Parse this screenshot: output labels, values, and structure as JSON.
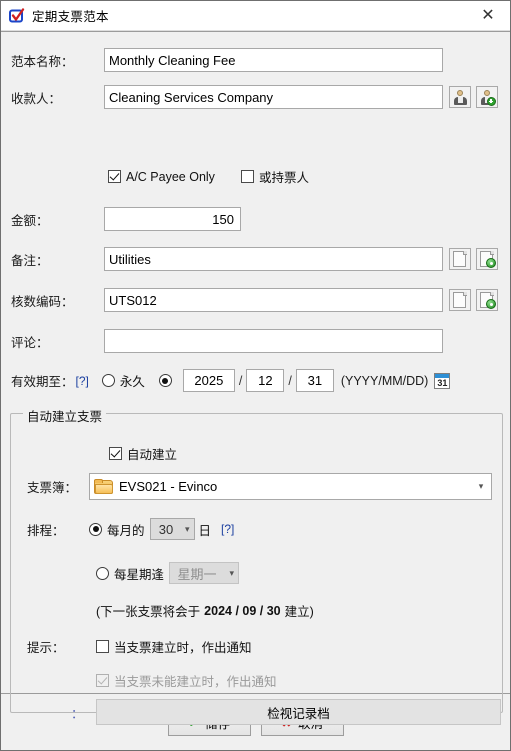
{
  "window": {
    "title": "定期支票范本",
    "icon": "cheque-check-icon",
    "close_label": "✕"
  },
  "form": {
    "template_name": {
      "label": "范本名称：",
      "value": "Monthly Cleaning Fee"
    },
    "payee": {
      "label": "收款人：",
      "value": "Cleaning Services Company",
      "select_payee_icon": "person-icon",
      "add_payee_icon": "person-add-icon"
    },
    "ac_payee_only": {
      "label": "A/C Payee Only",
      "checked": true
    },
    "or_bearer": {
      "label": "或持票人",
      "checked": false
    },
    "amount": {
      "label": "金额：",
      "value": "150"
    },
    "memo": {
      "label": "备注：",
      "value": "Utilities",
      "pick_icon": "document-icon",
      "add_icon": "document-add-icon"
    },
    "audit_code": {
      "label": "核数编码：",
      "value": "UTS012",
      "pick_icon": "document-icon",
      "add_icon": "document-add-icon"
    },
    "comment": {
      "label": "评论：",
      "value": ""
    },
    "valid_until": {
      "label": "有效期至：",
      "help": "[?]",
      "forever_label": "永久",
      "forever_selected": false,
      "date_selected": true,
      "year": "2025",
      "month": "12",
      "day": "31",
      "format_hint": "(YYYY/MM/DD)",
      "calendar_icon": "calendar-icon",
      "calendar_day": "31"
    }
  },
  "auto_group": {
    "title": "自动建立支票",
    "auto_create": {
      "label": "自动建立",
      "checked": true
    },
    "cheque_book": {
      "label": "支票簿：",
      "value": "EVS021 - Evinco",
      "folder_icon": "folder-icon",
      "arrow_icon": "chevron-down-icon"
    },
    "schedule": {
      "label": "排程：",
      "monthly": {
        "selected": true,
        "prefix": "每月的",
        "day_value": "30",
        "suffix": "日",
        "help": "[?]"
      },
      "weekly": {
        "selected": false,
        "prefix": "每星期逢",
        "weekday_value": "星期一"
      }
    },
    "next_cheque": {
      "prefix": "(下一张支票将会于",
      "date": "2024 / 09 / 30",
      "suffix": "建立)"
    },
    "alert": {
      "label": "提示：",
      "on_created": {
        "label": "当支票建立时，作出通知",
        "checked": false,
        "disabled": false
      },
      "on_failed": {
        "label": "当支票未能建立时，作出通知",
        "checked": true,
        "disabled": true
      }
    },
    "log": {
      "label": "：",
      "button": "检视记录档"
    }
  },
  "footer": {
    "save": {
      "label": "储存",
      "icon": "check-icon"
    },
    "cancel": {
      "label": "取消",
      "icon": "cross-icon"
    }
  }
}
